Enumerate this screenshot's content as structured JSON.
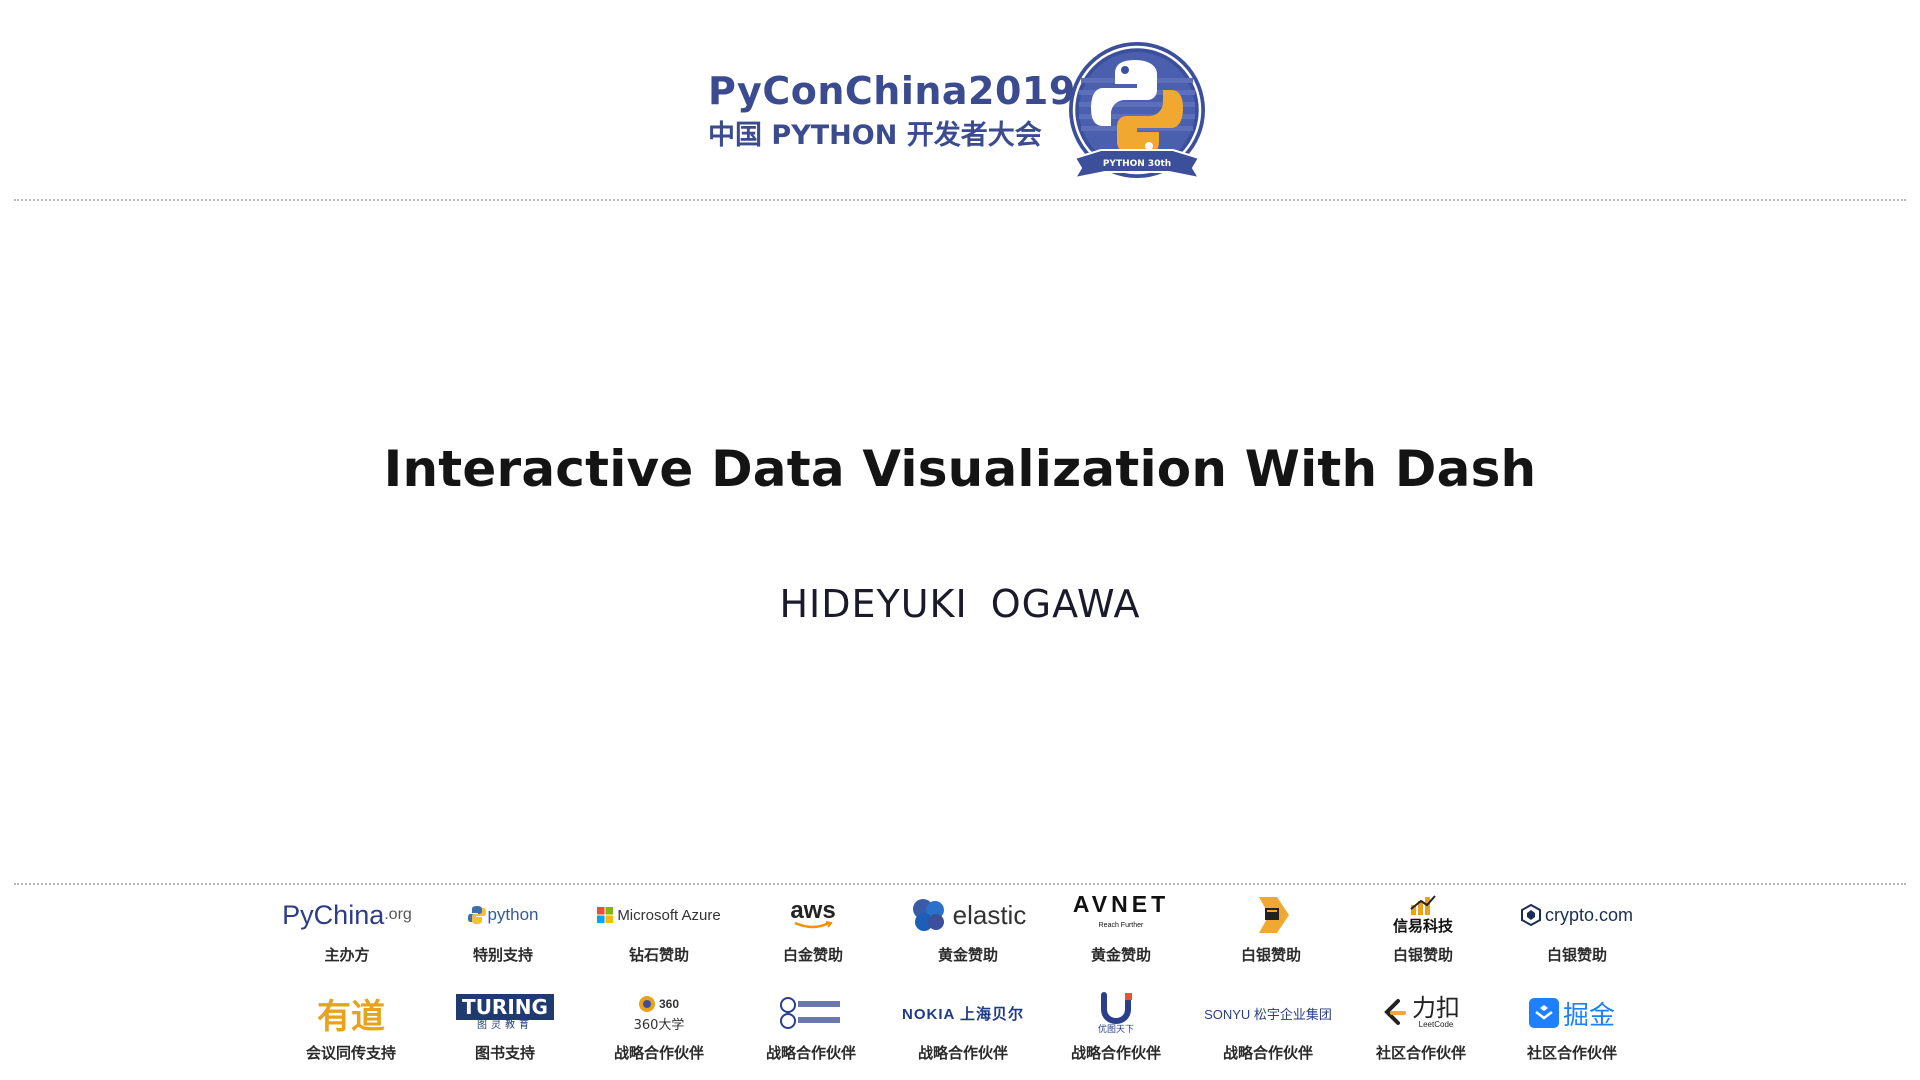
{
  "header": {
    "brand_line1": "PyConChina2019",
    "brand_line2": "中国 PYTHON 开发者大会",
    "badge_text": "PYTHON 30th"
  },
  "main": {
    "title": "Interactive Data Visualization With Dash",
    "author": "HIDEYUKI  OGAWA"
  },
  "sponsors": {
    "row1": [
      {
        "logo": "PyChina",
        "logo_suffix": ".org",
        "label": "主办方"
      },
      {
        "logo": "python",
        "label": "特别支持"
      },
      {
        "logo": "Microsoft Azure",
        "label": "钻石赞助"
      },
      {
        "logo": "aws",
        "label": "白金赞助"
      },
      {
        "logo": "elastic",
        "label": "黄金赞助"
      },
      {
        "logo": "AVNET",
        "logo_sub": "Reach Further",
        "label": "黄金赞助"
      },
      {
        "logo": "",
        "label": "白银赞助"
      },
      {
        "logo": "信易科技",
        "label": "白银赞助"
      },
      {
        "logo": "crypto.com",
        "label": "白银赞助"
      }
    ],
    "row2": [
      {
        "logo": "有道",
        "label": "会议同传支持"
      },
      {
        "logo": "TURING",
        "logo_sub": "图灵教育",
        "label": "图书支持"
      },
      {
        "logo": "360大学",
        "label": "战略合作伙伴"
      },
      {
        "logo": "",
        "label": "战略合作伙伴"
      },
      {
        "logo": "NOKIA 上海贝尔",
        "label": "战略合作伙伴"
      },
      {
        "logo": "优图天下",
        "label": "战略合作伙伴"
      },
      {
        "logo": "SONYU 松宇企业集团",
        "label": "战略合作伙伴"
      },
      {
        "logo": "力扣",
        "logo_sub": "LeetCode",
        "label": "社区合作伙伴"
      },
      {
        "logo": "掘金",
        "label": "社区合作伙伴"
      }
    ]
  },
  "colors": {
    "brand": "#3b4b8f",
    "python_blue": "#3b5ba8",
    "python_yellow": "#f0a830",
    "divider": "#b8b8b8"
  }
}
